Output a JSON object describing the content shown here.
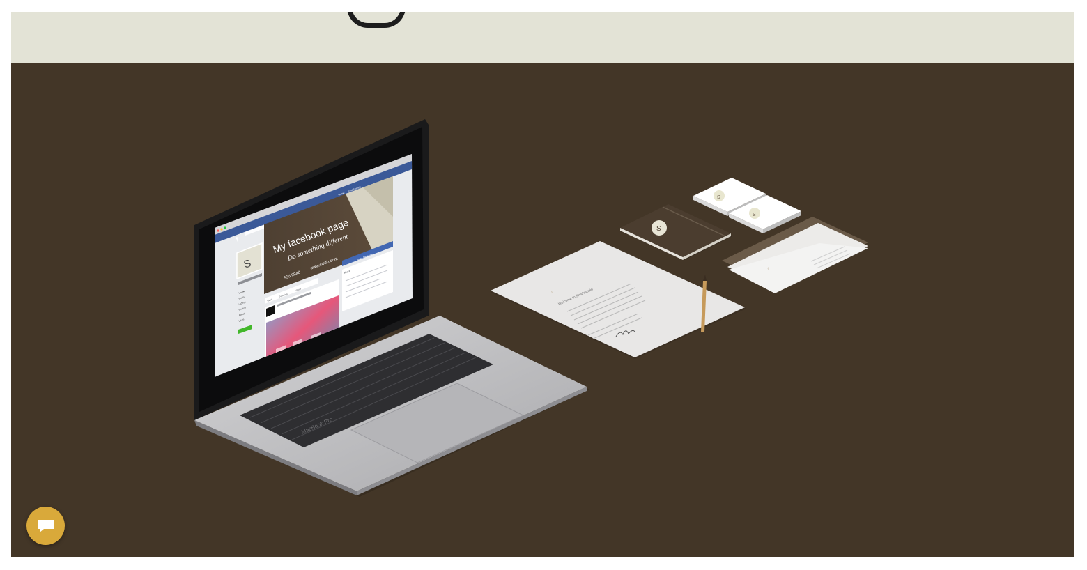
{
  "page": {
    "background": "#ffffff"
  },
  "top_band": {
    "color": "#e3e3d6"
  },
  "hero": {
    "background": "#433627",
    "laptop": {
      "brand": "MacBook Pro",
      "screen": {
        "facebook_logo": "f",
        "profile_letter": "S",
        "cover_title": "My facebook page",
        "cover_subtitle": "Do something different",
        "phone": "555 6948",
        "website": "www.smith.com",
        "send_message_label": "Send Message",
        "nav_home": "Home",
        "nav_find_friends": "Find Friends",
        "sidebar_items": [
          "Home",
          "Posts",
          "Videos",
          "Photos",
          "About",
          "Likes"
        ],
        "create_page_label": "Create a Page",
        "action_labels": [
          "Liked",
          "Following",
          "Share"
        ],
        "about_label": "About"
      }
    },
    "stationery": {
      "logo_letter": "S",
      "letter_heading": "Welcome to Smithstudio"
    }
  },
  "chat": {
    "icon": "chat-bubble-icon",
    "color": "#d9a93a"
  }
}
